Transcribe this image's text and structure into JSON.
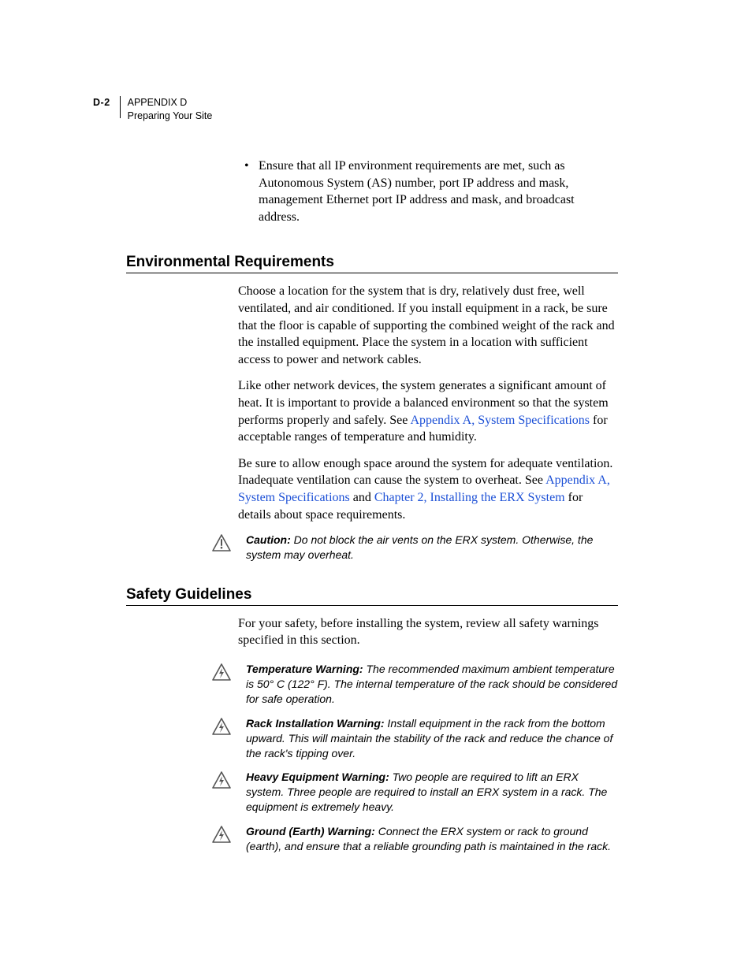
{
  "header": {
    "pageNumber": "D-2",
    "appendixLine": "APPENDIX D",
    "titleLine": "Preparing Your Site"
  },
  "bullet": {
    "text": "Ensure that all IP environment requirements are met, such as Autonomous System (AS) number, port IP address and mask, management Ethernet port IP address and mask, and broadcast address."
  },
  "sections": {
    "env": {
      "heading": "Environmental Requirements",
      "p1": "Choose a location for the system that is dry, relatively dust free, well ventilated, and air conditioned. If you install equipment in a rack, be sure that the floor is capable of supporting the combined weight of the rack and the installed equipment. Place the system in a location with sufficient access to power and network cables.",
      "p2a": "Like other network devices, the system generates a significant amount of heat. It is important to provide a balanced environment so that the system performs properly and safely. See ",
      "p2link": "Appendix A, System Specifications",
      "p2b": " for acceptable ranges of temperature and humidity.",
      "p3a": "Be sure to allow enough space around the system for adequate ventilation. Inadequate ventilation can cause the system to overheat. See ",
      "p3link1": "Appendix A, System Specifications",
      "p3mid": " and ",
      "p3link2": "Chapter 2, Installing the ERX System",
      "p3b": " for details about space requirements.",
      "caution": {
        "lead": "Caution:",
        "text": "  Do not block the air vents on the ERX system. Otherwise, the system may overheat."
      }
    },
    "safety": {
      "heading": "Safety Guidelines",
      "intro": "For your safety, before installing the system, review all safety warnings specified in this section.",
      "warnings": [
        {
          "lead": "Temperature Warning:",
          "text": " The recommended maximum ambient temperature is 50° C (122° F). The internal temperature of the rack should be considered for safe operation."
        },
        {
          "lead": "Rack Installation Warning:",
          "text": " Install equipment in the rack from the bottom upward. This will maintain the stability of the rack and reduce the chance of the rack's tipping over."
        },
        {
          "lead": "Heavy Equipment Warning:",
          "text": " Two people are required to lift an ERX system. Three people are required to install an ERX system in a rack. The equipment is extremely heavy."
        },
        {
          "lead": "Ground (Earth) Warning:",
          "text": " Connect the ERX system or rack to ground (earth), and ensure that a reliable grounding path is maintained in the rack."
        }
      ]
    }
  }
}
